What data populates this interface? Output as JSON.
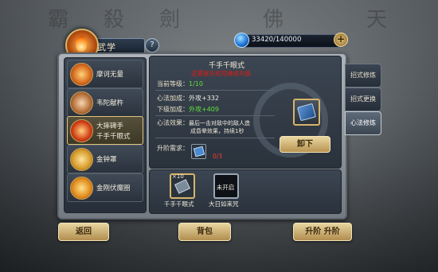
{
  "header": {
    "title": "武学",
    "help": "?",
    "currency": "33420/140000",
    "plus": "+"
  },
  "skills": [
    {
      "name": "摩诃无量"
    },
    {
      "name": "韦陀献杵"
    },
    {
      "name": "大摔碑手",
      "sub": "千手千眼式",
      "active": true
    },
    {
      "name": "金钟罩"
    },
    {
      "name": "金刚伏魔圈"
    }
  ],
  "detail": {
    "title": "千手千眼式",
    "warning": "还需提升招可继续升级",
    "level_label": "当前等级：",
    "level_value": "1/10",
    "bonus_label": "心法加成：",
    "bonus_value": "外攻+332",
    "next_label": "下级加成：",
    "next_value": "外攻+409",
    "effect_label": "心法效果：",
    "effect_line1": "最后一击对敌中的敌人造",
    "effect_line2": "成昏晕效果，持续1秒",
    "req_label": "升阶需求：",
    "req_count": "0/3",
    "unload_button": "卸下"
  },
  "slots": [
    {
      "count": "×10",
      "label": "千手千眼式"
    },
    {
      "lock": "未开启",
      "label": "大日如来咒"
    }
  ],
  "tabs": [
    "招式修炼",
    "招式更换",
    "心法修炼"
  ],
  "buttons": {
    "back": "返回",
    "bag": "背包",
    "upgrade": "升阶 升阶"
  }
}
